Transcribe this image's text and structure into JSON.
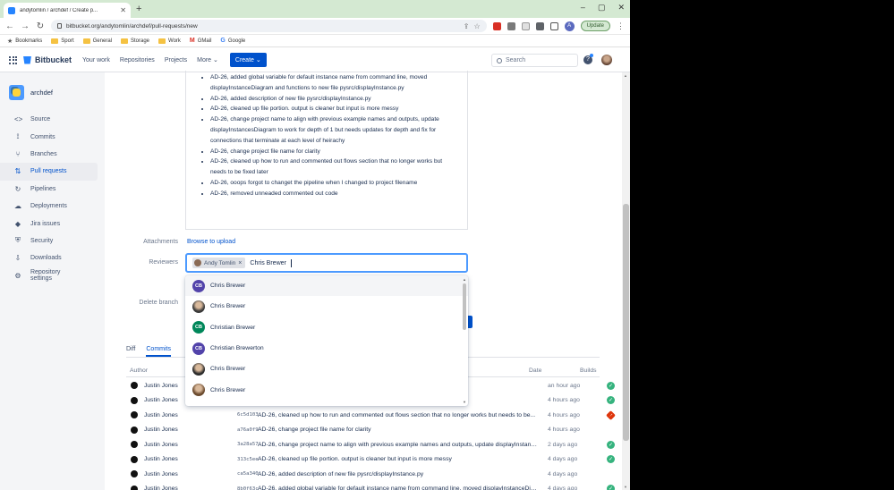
{
  "browser": {
    "tab_title": "andytomlin / archdef / Create p...",
    "url": "bitbucket.org/andytomlin/archdef/pull-requests/new",
    "new_tab": "+",
    "update_label": "Update",
    "profile_initial": "A",
    "bookmarks": [
      "Bookmarks",
      "Sport",
      "General",
      "Storage",
      "Work",
      "GMail",
      "Google"
    ]
  },
  "header": {
    "product": "Bitbucket",
    "nav": [
      "Your work",
      "Repositories",
      "Projects",
      "More"
    ],
    "create": "Create",
    "search_placeholder": "Search",
    "help": "?"
  },
  "sidebar": {
    "repo": "archdef",
    "items": [
      {
        "label": "Source",
        "icon": "source-icon",
        "glyph": "<>"
      },
      {
        "label": "Commits",
        "icon": "commits-icon",
        "glyph": "⟟"
      },
      {
        "label": "Branches",
        "icon": "branches-icon",
        "glyph": "⑂"
      },
      {
        "label": "Pull requests",
        "icon": "pull-requests-icon",
        "glyph": "⇅",
        "active": true
      },
      {
        "label": "Pipelines",
        "icon": "pipelines-icon",
        "glyph": "↻"
      },
      {
        "label": "Deployments",
        "icon": "deployments-icon",
        "glyph": "☁"
      },
      {
        "label": "Jira issues",
        "icon": "jira-icon",
        "glyph": "◆"
      },
      {
        "label": "Security",
        "icon": "security-icon",
        "glyph": "⛨"
      },
      {
        "label": "Downloads",
        "icon": "downloads-icon",
        "glyph": "⇩"
      },
      {
        "label": "Repository settings",
        "icon": "settings-icon",
        "glyph": "⚙"
      }
    ]
  },
  "description": {
    "items": [
      "AD-26, added global variable for default instance name from command line, moved displayInstanceDiagram and functions to new file pysrc/displayInstance.py",
      "AD-26, added description of new file pysrc/displayInstance.py",
      "AD-26, cleaned up file portion. output is cleaner but input is more messy",
      "AD-26, change project name to align with previous example names and outputs, update displayInstancesDiagram to work for depth of 1 but needs updates for depth and fix for connections that terminate at each level of heirachy",
      "AD-26, change project file name for clarity",
      "AD-26, cleaned up how to run and commented out flows section that no longer works but needs to be fixed later",
      "AD-26, ooops forgot to changet the pipeline when I changed to project filename",
      "AD-26, removed unneaded commented out code"
    ]
  },
  "form": {
    "attachments_label": "Attachments",
    "browse_label": "Browse to upload",
    "reviewers_label": "Reviewers",
    "chip_name": "Andy Tomlin",
    "typed_value": "Chris Brewer",
    "delete_branch_label": "Delete branch"
  },
  "suggestions": [
    {
      "name": "Chris Brewer",
      "initials": "CB",
      "color": "#5243aa",
      "photo": false
    },
    {
      "name": "Chris Brewer",
      "initials": "",
      "color": "#3a3a3a",
      "photo": true
    },
    {
      "name": "Christian Brewer",
      "initials": "CB",
      "color": "#00875a",
      "photo": false
    },
    {
      "name": "Christian Brewerton",
      "initials": "CB",
      "color": "#5243aa",
      "photo": false
    },
    {
      "name": "Chris Brewer",
      "initials": "",
      "color": "#2b2b2b",
      "photo": true
    },
    {
      "name": "Chris Brewer",
      "initials": "",
      "color": "#6b4a2e",
      "photo": true
    }
  ],
  "tabs": [
    "Diff",
    "Commits"
  ],
  "commits": {
    "headers": {
      "author": "Author",
      "date": "Date",
      "builds": "Builds"
    },
    "rows": [
      {
        "author": "Justin Jones",
        "hash": "",
        "message": "",
        "date": "an hour ago",
        "build": "success"
      },
      {
        "author": "Justin Jones",
        "hash": "",
        "message": "",
        "date": "4 hours ago",
        "build": "success"
      },
      {
        "author": "Justin Jones",
        "hash": "6c5d103",
        "message": "AD-26, cleaned up how to run and commented out flows section that no longer works but needs to be...",
        "date": "4 hours ago",
        "build": "failed"
      },
      {
        "author": "Justin Jones",
        "hash": "a76a0f9",
        "message": "AD-26, change project file name for clarity",
        "date": "4 hours ago",
        "build": "none"
      },
      {
        "author": "Justin Jones",
        "hash": "3a28a57",
        "message": "AD-26, change project name to align with previous example names and outputs, update displayInstanc...",
        "date": "2 days ago",
        "build": "success"
      },
      {
        "author": "Justin Jones",
        "hash": "313c5ee",
        "message": "AD-26, cleaned up file portion. output is cleaner but input is more messy",
        "date": "4 days ago",
        "build": "success"
      },
      {
        "author": "Justin Jones",
        "hash": "ca5a340",
        "message": "AD-26, added description of new file pysrc/displayInstance.py",
        "date": "4 days ago",
        "build": "none"
      },
      {
        "author": "Justin Jones",
        "hash": "8b0f63c",
        "message": "AD-26, added global variable for default instance name from command line, moved displayInstanceDia...",
        "date": "4 days ago",
        "build": "success"
      }
    ]
  },
  "colors": {
    "success": "#36b37e",
    "failed": "#de350b",
    "accent": "#0052cc"
  }
}
